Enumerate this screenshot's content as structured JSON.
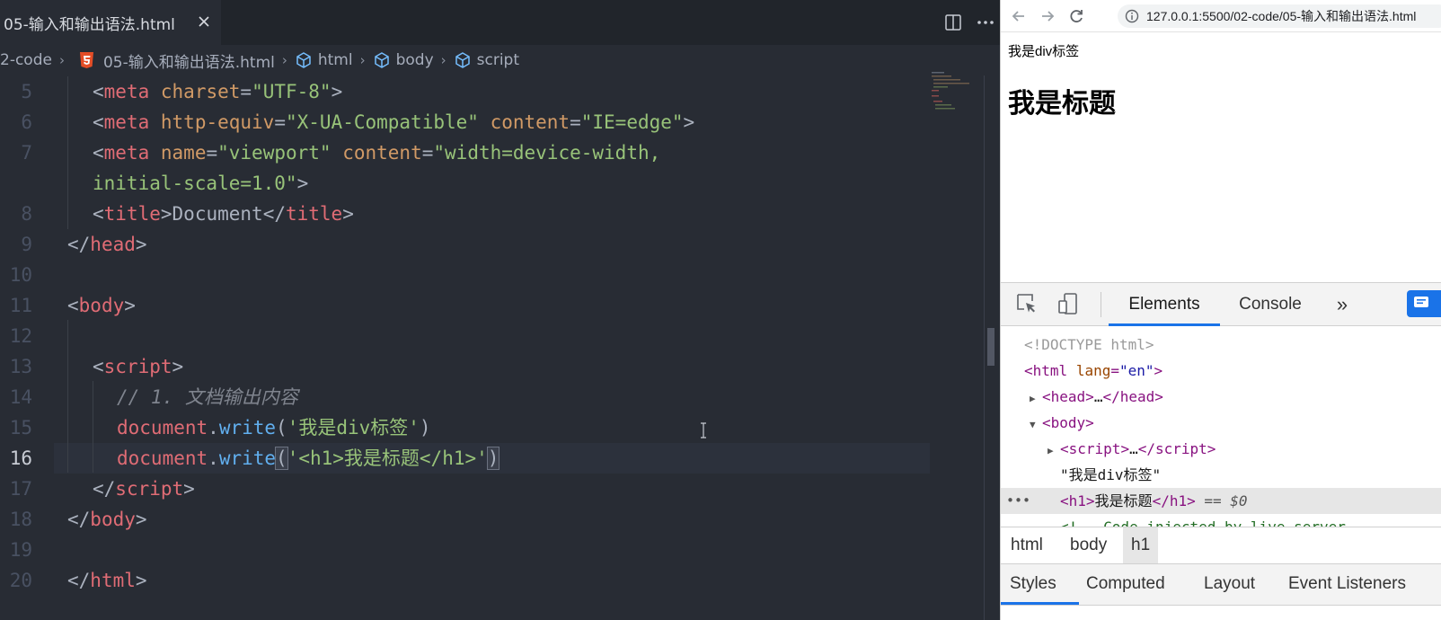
{
  "editor": {
    "tab": {
      "title": "05-输入和输出语法.html"
    },
    "breadcrumb": [
      "2-code",
      "05-输入和输出语法.html",
      "html",
      "body",
      "script"
    ],
    "active_line": 16,
    "line_numbers": [
      "5",
      "6",
      "7",
      "",
      "8",
      "9",
      "10",
      "11",
      "12",
      "13",
      "14",
      "15",
      "16",
      "17",
      "18",
      "19",
      "20"
    ],
    "code": {
      "l5": {
        "meta": "meta",
        "charset": "charset",
        "utf8": "\"UTF-8\""
      },
      "l6": {
        "meta": "meta",
        "http_equiv": "http-equiv",
        "xua": "\"X-UA-Compatible\"",
        "content": "content",
        "ie": "\"IE=edge\""
      },
      "l7": {
        "meta": "meta",
        "name": "name",
        "viewport": "\"viewport\"",
        "content": "content",
        "val1": "\"width=device-width,",
        "val2": "initial-scale=1.0\""
      },
      "l8": {
        "title": "title",
        "text": "Document"
      },
      "l9": {
        "head": "head"
      },
      "l11": {
        "body": "body"
      },
      "l13": {
        "script": "script"
      },
      "l14": {
        "comment": "// 1. 文档输出内容"
      },
      "l15": {
        "obj": "document",
        "fn": "write",
        "str": "'我是div标签'"
      },
      "l16": {
        "obj": "document",
        "fn": "write",
        "str": "'<h1>我是标题</h1>'"
      },
      "l17": {
        "script": "script"
      },
      "l18": {
        "body": "body"
      },
      "l20": {
        "html": "html"
      }
    }
  },
  "browser": {
    "url": "127.0.0.1:5500/02-code/05-输入和输出语法.html",
    "page": {
      "div_text": "我是div标签",
      "h1_text": "我是标题"
    },
    "devtools": {
      "tabs": {
        "elements": "Elements",
        "console": "Console",
        "more": "»"
      },
      "dom": {
        "doctype": "<!DOCTYPE html>",
        "html_tag": "html",
        "lang_attr": "lang",
        "lang_val": "\"en\"",
        "head_line": "head",
        "head_ellipsis": "…",
        "body_tag": "body",
        "script_tag": "script",
        "script_ellipsis": "…",
        "text_node": "\"我是div标签\"",
        "h1_tag": "h1",
        "h1_text": "我是标题",
        "selected_marker": "== $0",
        "comment": "<!-- Code injected by live-server -"
      },
      "crumbs": [
        "html",
        "body",
        "h1"
      ],
      "subtabs": [
        "Styles",
        "Computed",
        "Layout",
        "Event Listeners"
      ]
    }
  }
}
